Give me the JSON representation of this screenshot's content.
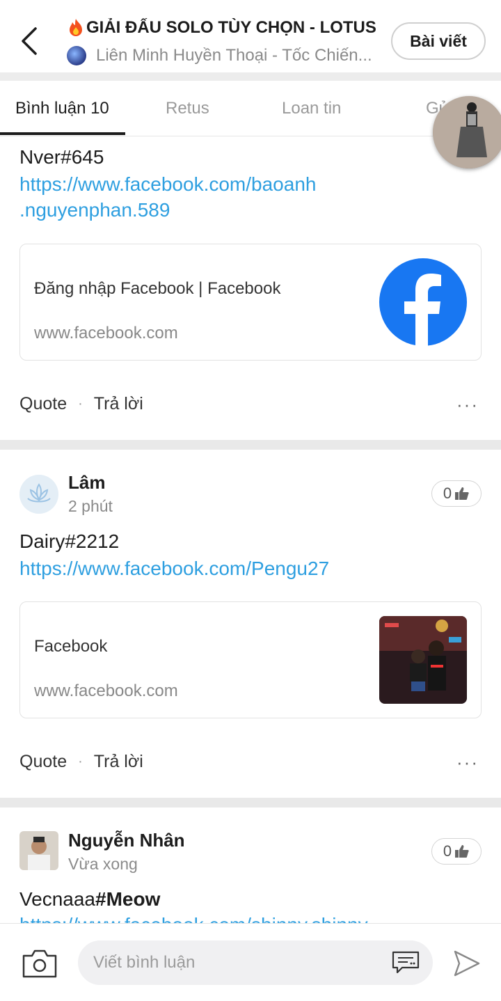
{
  "header": {
    "title": "GIẢI ĐẤU SOLO TÙY CHỌN - LOTUS ...",
    "subtitle": "Liên Minh Huyền Thoại - Tốc Chiến...",
    "post_button": "Bài viết"
  },
  "tabs": [
    {
      "label": "Bình luận 10",
      "active": true
    },
    {
      "label": "Retus",
      "active": false
    },
    {
      "label": "Loan tin",
      "active": false
    },
    {
      "label": "Gửi",
      "active": false
    }
  ],
  "comments": [
    {
      "text": "Nver#645",
      "link_line1": "https://www.facebook.com/baoanh",
      "link_line2": ".nguyenphan.589",
      "card": {
        "title": "Đăng nhập Facebook | Facebook",
        "domain": "www.facebook.com",
        "thumb": "facebook-logo"
      },
      "quote": "Quote",
      "reply": "Trả lời",
      "more": "···"
    },
    {
      "author": "Lâm",
      "time": "2 phút",
      "likes": "0",
      "text": "Dairy#2212",
      "link_line1": "https://www.facebook.com/Pengu27",
      "card": {
        "title": "Facebook",
        "domain": "www.facebook.com",
        "thumb": "photo"
      },
      "quote": "Quote",
      "reply": "Trả lời",
      "more": "···"
    },
    {
      "author": "Nguyễn Nhân",
      "time": "Vừa xong",
      "likes": "0",
      "text_plain": "Vecnaaa",
      "text_bold": "#Meow",
      "link_line1": "https://www.facebook.com/shinny.shinny"
    }
  ],
  "composer": {
    "placeholder": "Viết bình luận"
  },
  "colors": {
    "link": "#2e9fe0",
    "facebook_blue": "#1877f2",
    "separator": "#e9e9e9"
  }
}
